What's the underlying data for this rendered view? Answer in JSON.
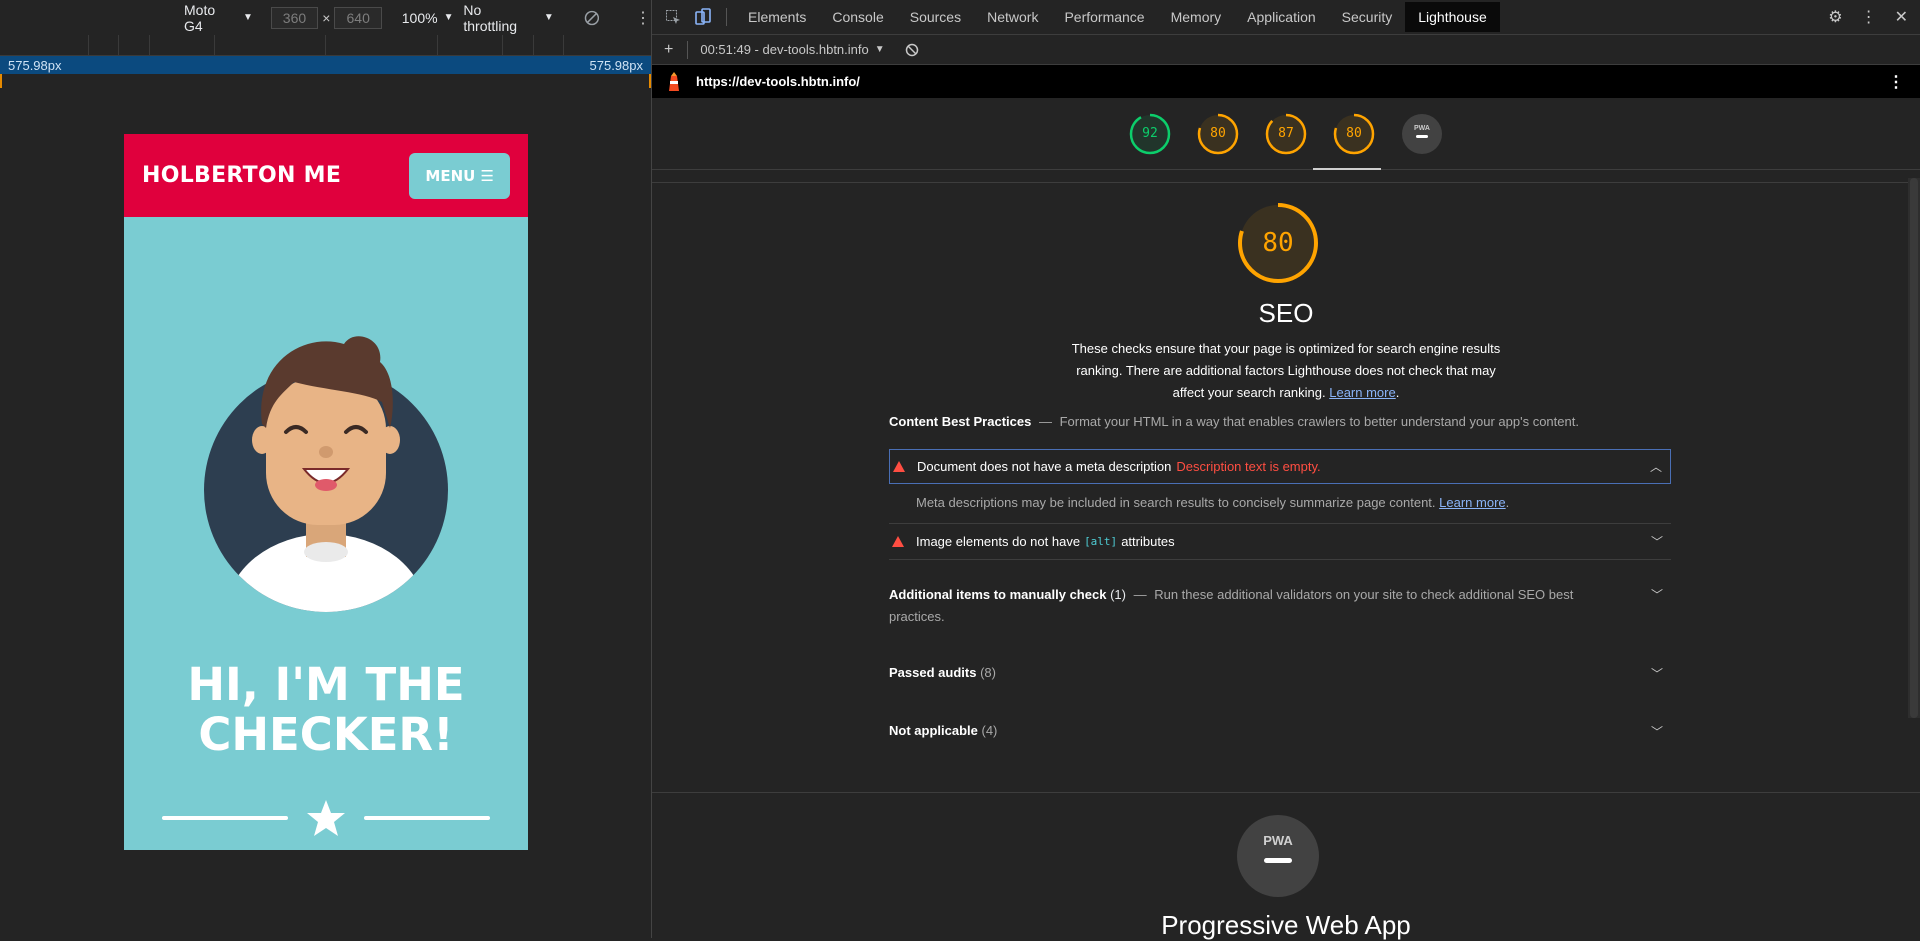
{
  "device_toolbar": {
    "device": "Moto G4",
    "width": "360",
    "height": "640",
    "times": "×",
    "zoom": "100%",
    "throttling": "No throttling"
  },
  "ruler": {
    "left_label": "575.98px",
    "right_label": "575.98px"
  },
  "phone": {
    "brand": "HOLBERTON ME",
    "menu_label": "MENU ☰",
    "hero_line1": "HI, I'M THE",
    "hero_line2": "CHECKER!"
  },
  "devtools": {
    "tabs": [
      "Elements",
      "Console",
      "Sources",
      "Network",
      "Performance",
      "Memory",
      "Application",
      "Security",
      "Lighthouse"
    ],
    "active_tab": "Lighthouse",
    "report_time": "00:51:49 - dev-tools.hbtn.info",
    "url": "https://dev-tools.hbtn.info/"
  },
  "scores": [
    {
      "value": "92",
      "fraction": 0.92,
      "color": "#0cce6b"
    },
    {
      "value": "80",
      "fraction": 0.8,
      "color": "#ffa400"
    },
    {
      "value": "87",
      "fraction": 0.87,
      "color": "#ffa400"
    },
    {
      "value": "80",
      "fraction": 0.8,
      "color": "#ffa400"
    },
    {
      "value": "PWA",
      "fraction": 0,
      "color": "#9e9e9e"
    }
  ],
  "seo": {
    "score": "80",
    "score_fraction": 0.8,
    "title": "SEO",
    "desc_line1": "These checks ensure that your page is optimized for search engine results",
    "desc_line2": "ranking. There are additional factors Lighthouse does not check that may",
    "desc_line3": "affect your search ranking.",
    "learn_more": "Learn more",
    "period": ".",
    "cbp_title": "Content Best Practices",
    "dash": "—",
    "cbp_desc": "Format your HTML in a way that enables crawlers to better understand your app's content.",
    "audit1_title": "Document does not have a meta description",
    "audit1_error": "Description text is empty.",
    "audit1_detail": "Meta descriptions may be included in search results to concisely summarize page content.",
    "audit2_pre": "Image elements do not have",
    "audit2_code": "[alt]",
    "audit2_post": "attributes",
    "manual_title": "Additional items to manually check",
    "manual_count": "(1)",
    "manual_desc": "Run these additional validators on your site to check additional SEO best",
    "manual_desc2": "practices.",
    "passed_title": "Passed audits",
    "passed_count": "(8)",
    "na_title": "Not applicable",
    "na_count": "(4)"
  },
  "pwa": {
    "badge": "PWA",
    "title": "Progressive Web App"
  },
  "colors": {
    "accent_red": "#e0003d",
    "teal": "#7accd2",
    "warn": "#ff4e42",
    "pass": "#0cce6b",
    "average": "#ffa400"
  }
}
